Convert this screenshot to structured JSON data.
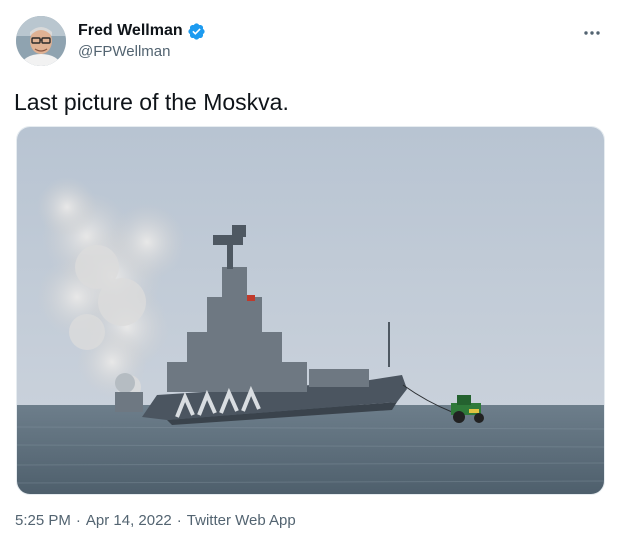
{
  "author": {
    "display_name": "Fred Wellman",
    "handle": "@FPWellman",
    "verified": true,
    "avatar_icon": "avatar-photo"
  },
  "tweet": {
    "text": "Last picture of the Moskva.",
    "media_icon": "warship-sinking-photo"
  },
  "meta": {
    "time": "5:25 PM",
    "separator": "·",
    "date": "Apr 14, 2022",
    "source": "Twitter Web App"
  },
  "icons": {
    "more": "more-options-icon",
    "verified": "verified-badge-icon"
  },
  "colors": {
    "verified_blue": "#1d9bf0",
    "secondary_text": "#536471",
    "primary_text": "#0f1419"
  }
}
